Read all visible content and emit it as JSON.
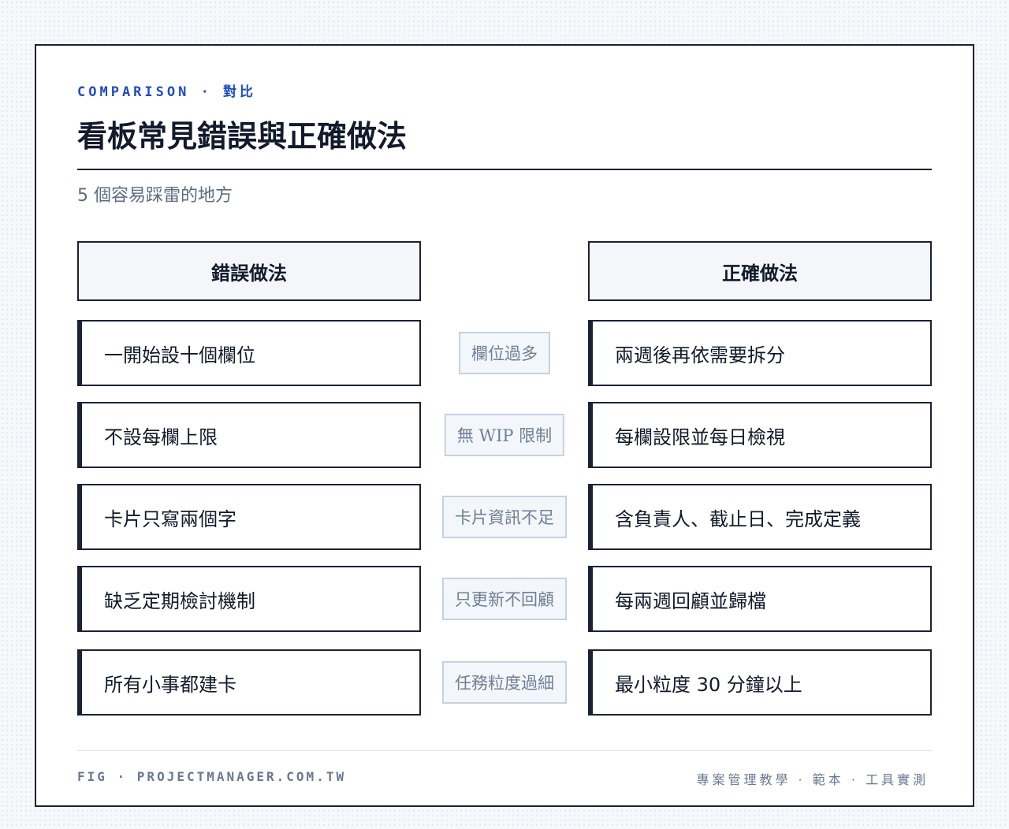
{
  "header": {
    "eyebrow": "COMPARISON · 對比",
    "title": "看板常見錯誤與正確做法",
    "subtitle": "5 個容易踩雷的地方"
  },
  "columns": {
    "wrong": "錯誤做法",
    "right": "正確做法"
  },
  "rows": [
    {
      "wrong": "一開始設十個欄位",
      "tag": "欄位過多",
      "right": "兩週後再依需要拆分"
    },
    {
      "wrong": "不設每欄上限",
      "tag": "無 WIP 限制",
      "right": "每欄設限並每日檢視"
    },
    {
      "wrong": "卡片只寫兩個字",
      "tag": "卡片資訊不足",
      "right": "含負責人、截止日、完成定義"
    },
    {
      "wrong": "缺乏定期檢討機制",
      "tag": "只更新不回顧",
      "right": "每兩週回顧並歸檔"
    },
    {
      "wrong": "所有小事都建卡",
      "tag": "任務粒度過細",
      "right": "最小粒度 30 分鐘以上"
    }
  ],
  "footer": {
    "left": "FIG · PROJECTMANAGER.COM.TW",
    "right": "專案管理教學 · 範本 · 工具實測"
  }
}
